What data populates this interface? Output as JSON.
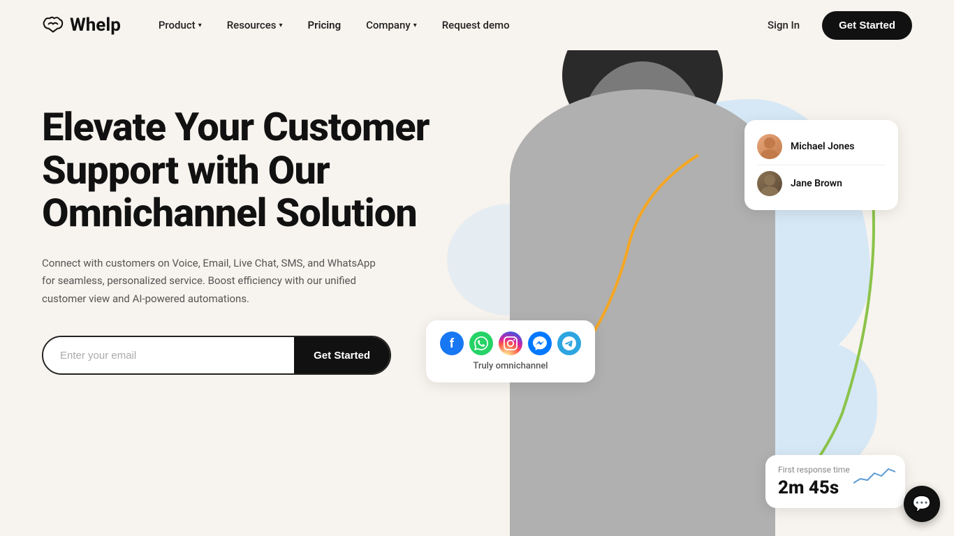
{
  "brand": {
    "name": "Whelp",
    "logo_alt": "Whelp logo"
  },
  "nav": {
    "items": [
      {
        "label": "Product",
        "has_dropdown": true
      },
      {
        "label": "Resources",
        "has_dropdown": true
      },
      {
        "label": "Pricing",
        "has_dropdown": false
      },
      {
        "label": "Company",
        "has_dropdown": true
      },
      {
        "label": "Request demo",
        "has_dropdown": false
      }
    ],
    "sign_in": "Sign In",
    "get_started": "Get Started"
  },
  "hero": {
    "title": "Elevate Your Customer Support with Our Omnichannel Solution",
    "subtitle": "Connect with customers on Voice, Email, Live Chat, SMS, and WhatsApp for seamless, personalized service. Boost efficiency with our unified customer view and AI-powered automations.",
    "email_placeholder": "Enter your email",
    "cta_label": "Get Started"
  },
  "floating": {
    "agents": [
      {
        "name": "Michael Jones"
      },
      {
        "name": "Jane Brown"
      }
    ],
    "omni_label": "Truly omnichannel",
    "channels": [
      "Facebook",
      "WhatsApp",
      "Instagram",
      "Messenger",
      "Telegram"
    ],
    "response": {
      "label": "First response time",
      "value": "2m 45s"
    }
  }
}
